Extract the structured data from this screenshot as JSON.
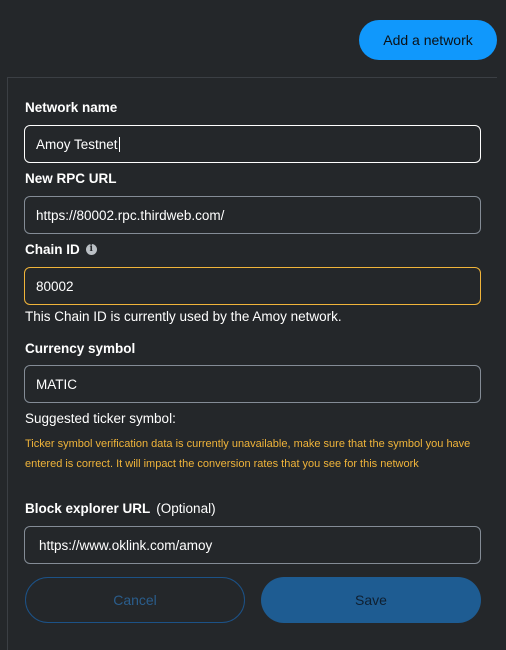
{
  "header": {
    "add_network_label": "Add a network"
  },
  "form": {
    "network_name": {
      "label": "Network name",
      "value": "Amoy Testnet"
    },
    "rpc_url": {
      "label": "New RPC URL",
      "value": "https://80002.rpc.thirdweb.com/"
    },
    "chain_id": {
      "label": "Chain ID",
      "icon": "info-icon",
      "value": "80002",
      "message": "This Chain ID is currently used by the Amoy network."
    },
    "currency_symbol": {
      "label": "Currency symbol",
      "value": "MATIC",
      "suggested_label": "Suggested ticker symbol:",
      "warning": "Ticker symbol verification data is currently unavailable, make sure that the symbol you have entered is correct. It will impact the conversion rates that you see for this network"
    },
    "block_explorer": {
      "label": "Block explorer URL",
      "optional_label": "(Optional)",
      "value": "https://www.oklink.com/amoy"
    }
  },
  "actions": {
    "cancel_label": "Cancel",
    "save_label": "Save"
  },
  "colors": {
    "background": "#24272a",
    "accent": "#1098fc",
    "warning": "#f0b43a",
    "border": "#848c96"
  }
}
